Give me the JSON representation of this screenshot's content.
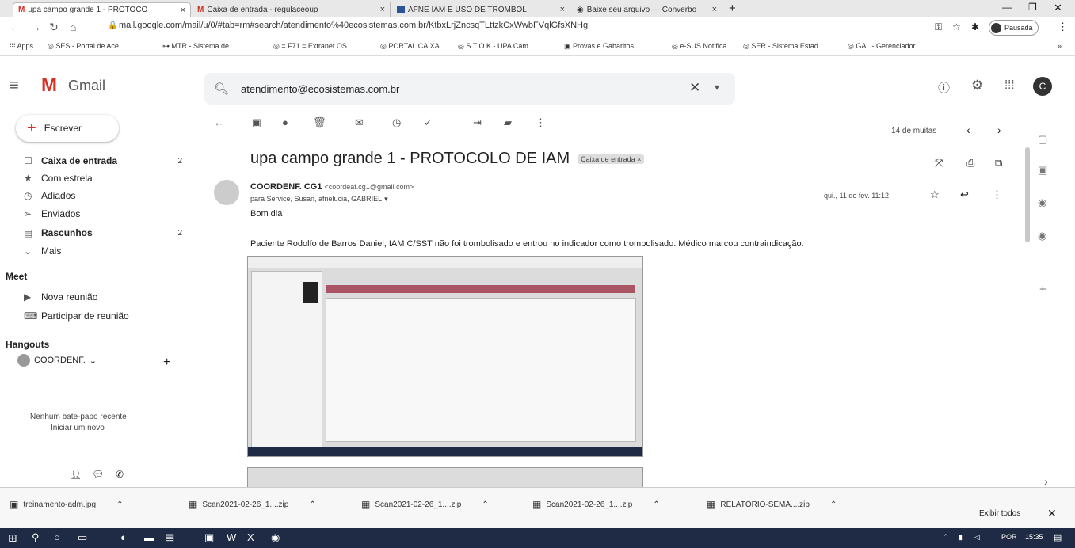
{
  "browser": {
    "tabs": [
      {
        "label": "upa campo grande 1 - PROTOCO"
      },
      {
        "label": "Caixa de entrada - regulaceoup"
      },
      {
        "label": "AFNE IAM E USO DE TROMBOL"
      },
      {
        "label": "Baixe seu arquivo — Converbo"
      }
    ],
    "url": "mail.google.com/mail/u/0/#tab=rm#search/atendimento%40ecosistemas.com.br/KtbxLrjZncsqTLttzkCxWwbFVqlGfsXNHg",
    "profile_label": "Pausada",
    "bookmarks": [
      "Apps",
      "SES - Portal de Ace...",
      "MTR - Sistema de...",
      "= F71 = Extranet OS...",
      "PORTAL CAIXA",
      "S T O K - UPA Cam...",
      "Provas e Gabaritos...",
      "e-SUS Notifica",
      "SER - Sistema Estad...",
      "GAL - Gerenciador..."
    ]
  },
  "gmail": {
    "logo": "Gmail",
    "search_value": "atendimento@ecosistemas.com.br",
    "compose": "Escrever",
    "nav": [
      {
        "label": "Caixa de entrada",
        "count": "2",
        "icon": "inbox-icon"
      },
      {
        "label": "Com estrela",
        "count": "",
        "icon": "star-icon"
      },
      {
        "label": "Adiados",
        "count": "",
        "icon": "clock-icon"
      },
      {
        "label": "Enviados",
        "count": "",
        "icon": "send-icon"
      },
      {
        "label": "Rascunhos",
        "count": "2",
        "icon": "draft-icon"
      },
      {
        "label": "Mais",
        "count": "",
        "icon": "chevron-down-icon"
      }
    ],
    "meet": {
      "title": "Meet",
      "new_meeting": "Nova reunião",
      "join_meeting": "Participar de reunião"
    },
    "hangouts": {
      "title": "Hangouts",
      "user": "COORDENF.",
      "empty_line1": "Nenhum bate-papo recente",
      "empty_line2": "Iniciar um novo"
    },
    "pagination": "14 de muitas",
    "message": {
      "subject": "upa campo grande 1 - PROTOCOLO DE IAM",
      "label": "Caixa de entrada",
      "sender_name": "COORDENF. CG1",
      "sender_email": "<coordeaf.cg1@gmail.com>",
      "recipients": "para Service, Susan, afnelucia, GABRIEL",
      "date": "qui., 11 de fev. 11:12",
      "greeting": "Bom dia",
      "body": "Paciente Rodolfo de Barros Daniel, IAM C/SST não foi trombolisado e entrou no indicador como trombolisado. Médico marcou contraindicação."
    }
  },
  "downloads": [
    {
      "label": "treinamento-adm.jpg"
    },
    {
      "label": "Scan2021-02-26_1....zip"
    },
    {
      "label": "Scan2021-02-26_1....zip"
    },
    {
      "label": "Scan2021-02-26_1....zip"
    },
    {
      "label": "RELATÓRIO-SEMA....zip"
    }
  ],
  "downloads_show_all": "Exibir todos",
  "taskbar": {
    "clock": "15:35",
    "lang": "POR"
  },
  "colors": {
    "gmail_red": "#d93025",
    "taskbar": "#1f2a44"
  }
}
